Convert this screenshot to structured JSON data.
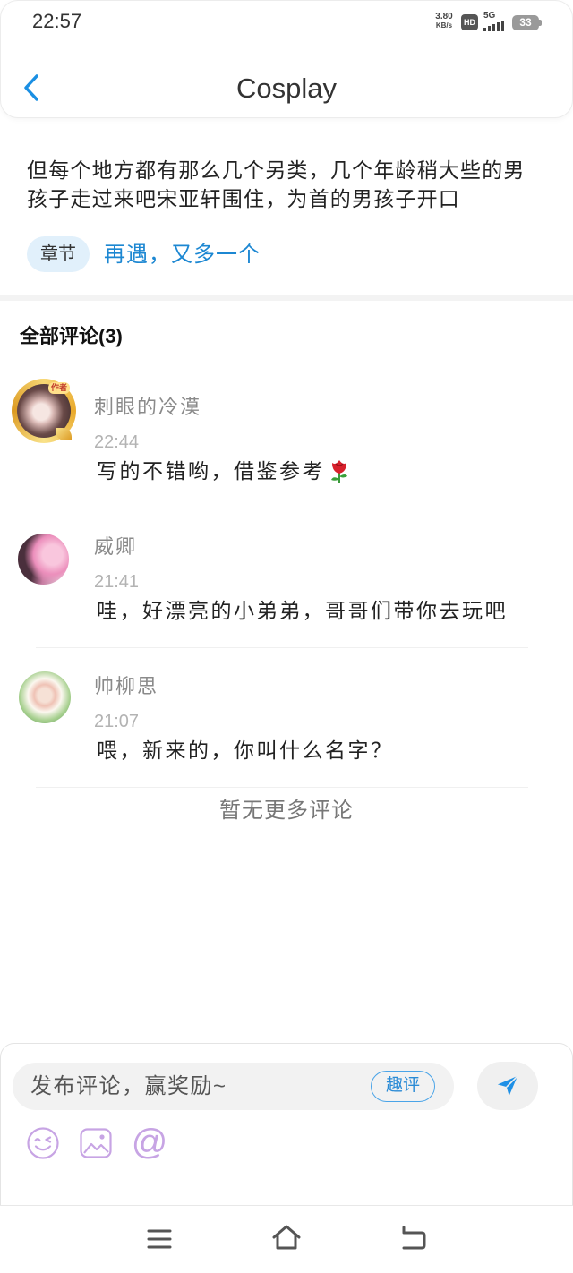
{
  "status_bar": {
    "time": "22:57",
    "net_speed": "3.80",
    "net_speed_unit": "KB/s",
    "hd_label": "HD",
    "network_type": "5G",
    "battery_level": "33",
    "icons": [
      "hd-icon",
      "signal-icon",
      "battery-icon"
    ]
  },
  "header": {
    "title": "Cosplay",
    "back_icon": "chevron-left-icon"
  },
  "excerpt": {
    "text": "但每个地方都有那么几个另类，几个年龄稍大些的男孩子走过来吧宋亚轩围住，为首的男孩子开口"
  },
  "chapter": {
    "badge": "章节",
    "title": "再遇，又多一个"
  },
  "comments_section": {
    "heading": "全部评论(3)",
    "end_text": "暂无更多评论"
  },
  "comments": [
    {
      "name": "刺眼的冷漠",
      "time": "22:44",
      "text": "写的不错哟，借鉴参考",
      "emoji_icon": "rose-icon",
      "avatar_badge": "作者"
    },
    {
      "name": "威卿",
      "time": "21:41",
      "text": "哇，好漂亮的小弟弟，哥哥们带你去玩吧"
    },
    {
      "name": "帅柳思",
      "time": "21:07",
      "text": "喂，新来的，你叫什么名字？"
    }
  ],
  "composer": {
    "placeholder": "发布评论，赢奖励~",
    "fun_comment_label": "趣评",
    "send_icon": "send-icon",
    "tools": [
      {
        "icon": "emoji-icon"
      },
      {
        "icon": "image-icon"
      },
      {
        "icon": "at-icon",
        "glyph": "@"
      }
    ]
  },
  "nav_bar": {
    "icons": [
      "menu-icon",
      "home-icon",
      "back-icon"
    ]
  },
  "colors": {
    "accent": "#1a8fe3",
    "chapter_badge_bg": "#e1f0fb",
    "tool_icon": "#c7a4e4",
    "avatar_frame": "#f3c34a",
    "rose": "#d8202c"
  }
}
